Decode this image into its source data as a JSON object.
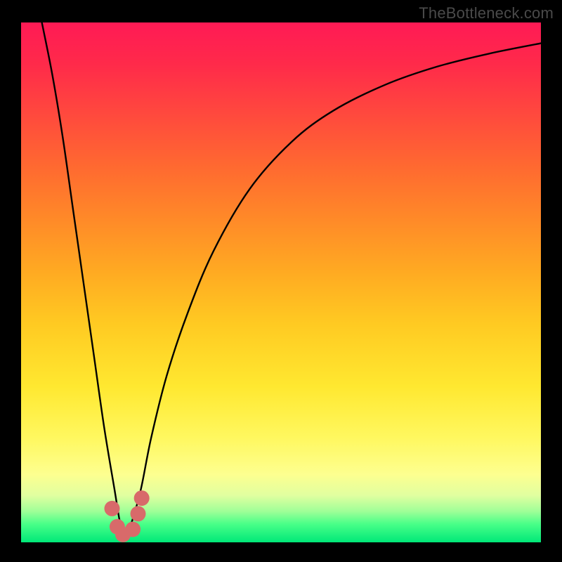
{
  "watermark": "TheBottleneck.com",
  "chart_data": {
    "type": "line",
    "title": "",
    "xlabel": "",
    "ylabel": "",
    "xlim": [
      0,
      100
    ],
    "ylim": [
      0,
      100
    ],
    "series": [
      {
        "name": "curve",
        "x": [
          4,
          6,
          8,
          10,
          12,
          14,
          16,
          18,
          19,
          20,
          21,
          23,
          25,
          28,
          32,
          37,
          44,
          52,
          60,
          70,
          80,
          90,
          100
        ],
        "y": [
          100,
          90,
          78,
          64,
          50,
          36,
          22,
          10,
          4,
          1,
          3,
          10,
          20,
          32,
          44,
          56,
          68,
          77,
          83,
          88,
          91.5,
          94,
          96
        ]
      }
    ],
    "markers": [
      {
        "x": 17.5,
        "y": 6.5
      },
      {
        "x": 18.5,
        "y": 3.0
      },
      {
        "x": 19.6,
        "y": 1.5
      },
      {
        "x": 21.5,
        "y": 2.5
      },
      {
        "x": 22.5,
        "y": 5.5
      },
      {
        "x": 23.2,
        "y": 8.5
      }
    ],
    "colors": {
      "curve": "#000000",
      "marker": "#d86a6a",
      "gradient_top": "#ff1a55",
      "gradient_bottom": "#00e878"
    }
  }
}
